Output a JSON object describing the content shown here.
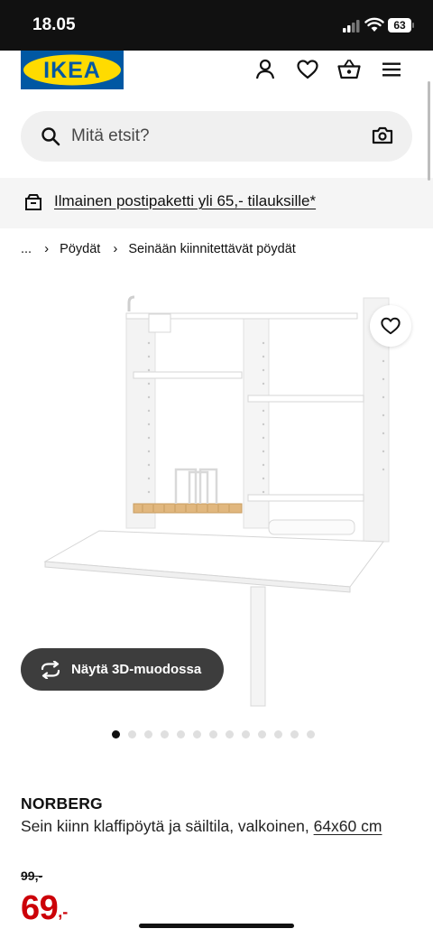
{
  "status": {
    "time": "18.05",
    "battery": "63"
  },
  "header": {
    "logo_text": "IKEA",
    "brand_colors": {
      "blue": "#0058a3",
      "yellow": "#ffdb00"
    }
  },
  "search": {
    "placeholder": "Mitä etsit?"
  },
  "banner": {
    "text": "Ilmainen postipaketti yli 65,- tilauksille*"
  },
  "breadcrumb": {
    "items": [
      "...",
      "Pöydät",
      "Seinään kiinnitettävät pöydät"
    ]
  },
  "gallery": {
    "button_3d": "Näytä 3D-muodossa",
    "slides_total": 13,
    "active_index": 0
  },
  "product": {
    "name": "NORBERG",
    "description": "Sein kiinn klaffipöytä ja säiltila, valkoinen, ",
    "dimensions": "64x60 cm",
    "old_price": "99,-",
    "price_whole": "69",
    "price_suffix": ",-"
  },
  "colors": {
    "price_red": "#cc0008",
    "button_dark": "#3d3d3d"
  }
}
